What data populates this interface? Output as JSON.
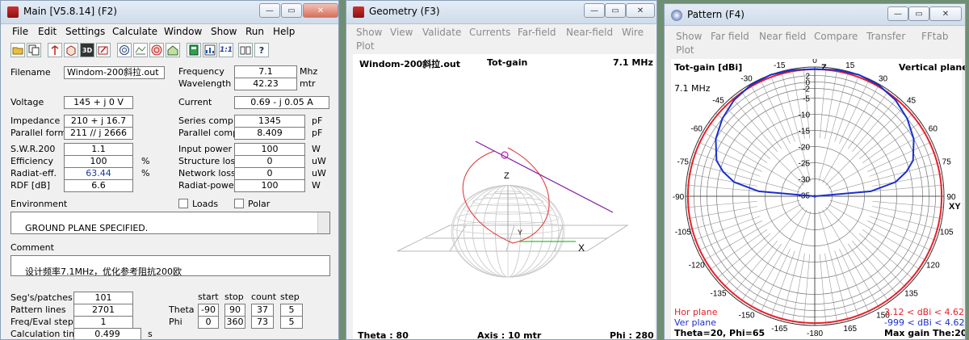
{
  "main": {
    "title": "Main [V5.8.14]  (F2)",
    "menu": [
      "File",
      "Edit",
      "Settings",
      "Calculate",
      "Window",
      "Show",
      "Run",
      "Help"
    ],
    "filename_label": "Filename",
    "filename": "Windom-200斜拉.out",
    "frequency_label": "Frequency",
    "frequency": "7.1",
    "frequency_unit": "Mhz",
    "wavelength_label": "Wavelength",
    "wavelength": "42.23",
    "wavelength_unit": "mtr",
    "voltage_label": "Voltage",
    "voltage": "145 + j 0 V",
    "current_label": "Current",
    "current": "0.69 - j 0.05 A",
    "impedance_label": "Impedance",
    "impedance": "210 + j 16.7",
    "series_comp_label": "Series comp.",
    "series_comp": "1345",
    "series_comp_unit": "pF",
    "parallel_form_label": "Parallel form",
    "parallel_form": "211 // j 2666",
    "parallel_comp_label": "Parallel comp.",
    "parallel_comp": "8.409",
    "parallel_comp_unit": "pF",
    "swr_label": "S.W.R.200",
    "swr": "1.1",
    "input_power_label": "Input power",
    "input_power": "100",
    "input_power_unit": "W",
    "efficiency_label": "Efficiency",
    "efficiency": "100",
    "efficiency_unit": "%",
    "structure_loss_label": "Structure loss",
    "structure_loss": "0",
    "structure_loss_unit": "uW",
    "radiat_eff_label": "Radiat-eff.",
    "radiat_eff": "63.44",
    "radiat_eff_unit": "%",
    "network_loss_label": "Network loss",
    "network_loss": "0",
    "network_loss_unit": "uW",
    "rdf_label": "RDF [dB]",
    "rdf": "6.6",
    "radiat_power_label": "Radiat-power",
    "radiat_power": "100",
    "radiat_power_unit": "W",
    "environment_label": "Environment",
    "loads_label": "Loads",
    "polar_label": "Polar",
    "environment_text": "GROUND PLANE SPECIFIED.\nWHERE WIRE ENDS TOUCH GROUND, CURRENT WILL BE INTERPOLATED",
    "comment_label": "Comment",
    "comment_text": "设计频率7.1MHz，优化参考阻抗200欧",
    "segs_label": "Seg's/patches",
    "segs": "101",
    "pattern_lines_label": "Pattern lines",
    "pattern_lines": "2701",
    "freq_eval_label": "Freq/Eval steps",
    "freq_eval": "1",
    "calc_time_label": "Calculation time",
    "calc_time": "0.499",
    "calc_time_unit": "s",
    "sweep_headers": [
      "start",
      "stop",
      "count",
      "step"
    ],
    "theta_label": "Theta",
    "theta": [
      "-90",
      "90",
      "37",
      "5"
    ],
    "phi_label": "Phi",
    "phi": [
      "0",
      "360",
      "73",
      "5"
    ],
    "toolbar_11": "1:1",
    "toolbar_3d": "3D"
  },
  "geometry": {
    "title": "Geometry   (F3)",
    "menu": [
      "Show",
      "View",
      "Validate",
      "Currents",
      "Far-field",
      "Near-field",
      "Wire"
    ],
    "menu2": "Plot",
    "file_label": "Windom-200斜拉.out",
    "mode_label": "Tot-gain",
    "freq_label": "7.1 MHz",
    "z_axis": "Z",
    "y_axis": "Y",
    "x_axis": "X",
    "theta_readout": "Theta : 80",
    "axis_readout": "Axis : 10 mtr",
    "phi_readout": "Phi : 280"
  },
  "pattern": {
    "title": "Pattern   (F4)",
    "menu": [
      "Show",
      "Far field",
      "Near field",
      "Compare",
      "Transfer",
      "FFtab"
    ],
    "menu2": "Plot",
    "gain_label": "Tot-gain [dBi]",
    "plane_label": "Vertical plane",
    "freq_label": "7.1 MHz",
    "angles": [
      {
        "label": "0",
        "deg": 0
      },
      {
        "label": "15",
        "deg": 15
      },
      {
        "label": "30",
        "deg": 30
      },
      {
        "label": "45",
        "deg": 45
      },
      {
        "label": "60",
        "deg": 60
      },
      {
        "label": "75",
        "deg": 75
      },
      {
        "label": "90",
        "deg": 90
      },
      {
        "label": "105",
        "deg": 105
      },
      {
        "label": "120",
        "deg": 120
      },
      {
        "label": "135",
        "deg": 135
      },
      {
        "label": "150",
        "deg": 150
      },
      {
        "label": "165",
        "deg": 165
      },
      {
        "label": "-180",
        "deg": 180
      },
      {
        "label": "-165",
        "deg": 195
      },
      {
        "label": "-150",
        "deg": 210
      },
      {
        "label": "-135",
        "deg": 225
      },
      {
        "label": "-120",
        "deg": 240
      },
      {
        "label": "-105",
        "deg": 255
      },
      {
        "label": "-90",
        "deg": 270
      },
      {
        "label": "-75",
        "deg": 285
      },
      {
        "label": "-60",
        "deg": 300
      },
      {
        "label": "-45",
        "deg": 315
      },
      {
        "label": "-30",
        "deg": 330
      },
      {
        "label": "-15",
        "deg": 345
      }
    ],
    "scale_labels": [
      "2",
      "0",
      "-2",
      "-5",
      "-10",
      "-15",
      "-20",
      "-25",
      "-30",
      "-35"
    ],
    "scale_db": [
      2,
      0,
      -2,
      -5,
      -10,
      -15,
      -20,
      -25,
      -30,
      -35
    ],
    "z_label": "Z",
    "xy_label": "XY",
    "hor_legend": "Hor plane",
    "hor_value": "3.12 < dBi < 4.62",
    "ver_legend": "Ver plane",
    "ver_value": "-999 < dBi < 4.62",
    "footer_left": "Theta=20, Phi=65",
    "footer_right": "Max gain The:20",
    "colors": {
      "hor": "#e8202a",
      "ver": "#1a2fd0"
    },
    "vertical_plane_trace": {
      "theta_deg": [
        -90,
        -85,
        -80,
        -75,
        -70,
        -60,
        -50,
        -40,
        -30,
        -20,
        -10,
        0,
        10,
        20,
        30,
        40,
        50,
        60,
        70,
        75,
        80,
        85,
        90
      ],
      "gain_dbi": [
        -999,
        -18,
        -10,
        -6,
        -3,
        0,
        2,
        3.5,
        4.3,
        4.62,
        4.3,
        4.0,
        4.3,
        4.62,
        4.3,
        3.5,
        2,
        0,
        -3,
        -6,
        -10,
        -18,
        -999
      ]
    }
  }
}
